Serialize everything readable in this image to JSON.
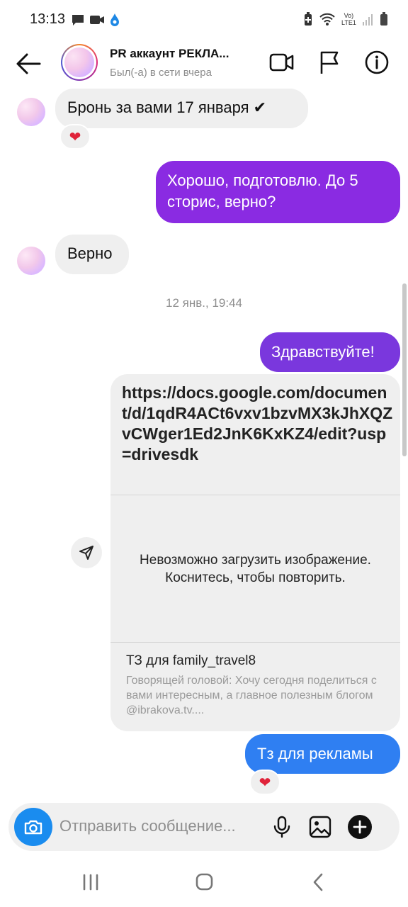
{
  "status_bar": {
    "time": "13:13",
    "network_label_top": "Vo)",
    "network_label_bottom": "LTE1"
  },
  "header": {
    "title": "PR аккаунт РЕКЛА...",
    "subtitle": "Был(-а) в сети вчера"
  },
  "messages": [
    {
      "id": "m1",
      "direction": "incoming",
      "text": "Бронь за вами 17 января ✔",
      "reaction": "❤"
    },
    {
      "id": "m2",
      "direction": "outgoing",
      "text": "Хорошо, подготовлю. До 5 сторис, верно?"
    },
    {
      "id": "m3",
      "direction": "incoming",
      "text": "Верно"
    },
    {
      "id": "m4",
      "direction": "outgoing",
      "text": "Здравствуйте!"
    },
    {
      "id": "m5",
      "direction": "outgoing",
      "text": "Тз для рекламы",
      "reaction": "❤"
    }
  ],
  "timestamp": "12 янв., 19:44",
  "link_card": {
    "url": "https://docs.google.com/document/d/1qdR4ACt6vxv1bzvMX3kJhXQZvCWger1Ed2JnK6KxKZ4/edit?usp=drivesdk",
    "image_error": "Невозможно загрузить изображение. Коснитесь, чтобы повторить.",
    "title": "ТЗ для family_travel8",
    "description": "Говорящей головой: Хочу сегодня поделиться с вами интересным, а главное полезным блогом @ibrakova.tv...."
  },
  "composer": {
    "placeholder": "Отправить сообщение..."
  },
  "colors": {
    "incoming_bubble": "#efefef",
    "outgoing_purple": "#8a2be2",
    "outgoing_blue": "#3b7bf0",
    "accent_blue": "#1a8cef",
    "reaction_heart": "#e0233a"
  }
}
